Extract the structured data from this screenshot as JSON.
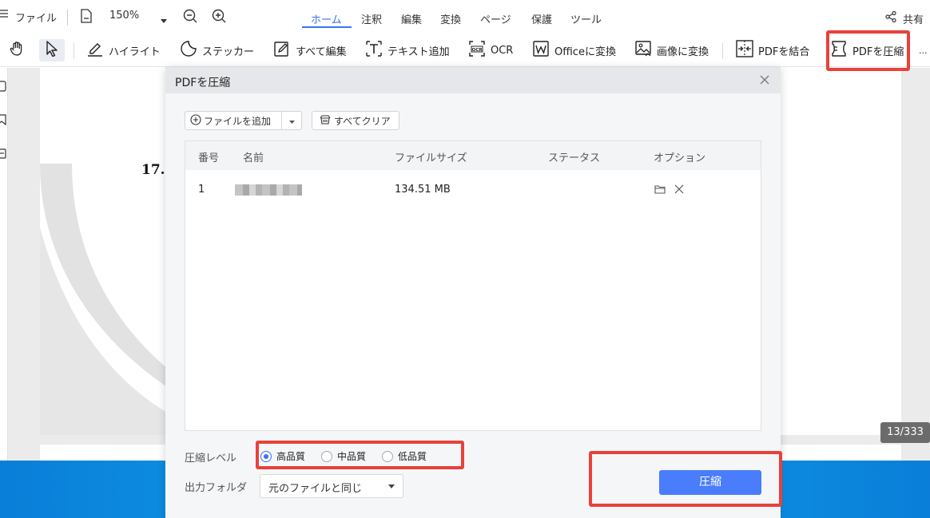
{
  "menubar": {
    "file_label": "ファイル",
    "zoom_value": "150%",
    "tabs": [
      {
        "label": "ホーム",
        "active": true
      },
      {
        "label": "注釈"
      },
      {
        "label": "編集"
      },
      {
        "label": "変換"
      },
      {
        "label": "ページ"
      },
      {
        "label": "保護"
      },
      {
        "label": "ツール"
      }
    ],
    "share_label": "共有"
  },
  "toolbar": {
    "items": [
      {
        "label": "ハイライト",
        "icon": "highlighter-icon"
      },
      {
        "label": "ステッカー",
        "icon": "sticker-icon"
      },
      {
        "label": "すべて編集",
        "icon": "edit-icon"
      },
      {
        "label": "テキスト追加",
        "icon": "text-add-icon"
      },
      {
        "label": "OCR",
        "icon": "ocr-icon"
      },
      {
        "label": "Officeに変換",
        "icon": "word-icon"
      },
      {
        "label": "画像に変換",
        "icon": "image-icon"
      },
      {
        "label": "PDFを結合",
        "icon": "merge-icon"
      },
      {
        "label": "PDFを圧縮",
        "icon": "compress-icon"
      }
    ],
    "more_label": "..."
  },
  "document": {
    "page_fragment": "17.",
    "page_counter": "13/333"
  },
  "dialog": {
    "title": "PDFを圧縮",
    "add_file_label": "ファイルを追加",
    "clear_all_label": "すべてクリア",
    "table": {
      "headers": [
        "番号",
        "名前",
        "ファイルサイズ",
        "ステータス",
        "オプション"
      ],
      "rows": [
        {
          "number": "1",
          "size": "134.51 MB",
          "status": ""
        }
      ]
    },
    "compression_level_label": "圧縮レベル",
    "levels": [
      {
        "label": "高品質",
        "selected": true
      },
      {
        "label": "中品質",
        "selected": false
      },
      {
        "label": "低品質",
        "selected": false
      }
    ],
    "output_folder_label": "出力フォルダ",
    "output_folder_value": "元のファイルと同じ",
    "compress_button": "圧縮"
  },
  "colors": {
    "accent": "#3a72f5",
    "primary_button": "#4a7dfb",
    "highlight": "#e8413a"
  }
}
